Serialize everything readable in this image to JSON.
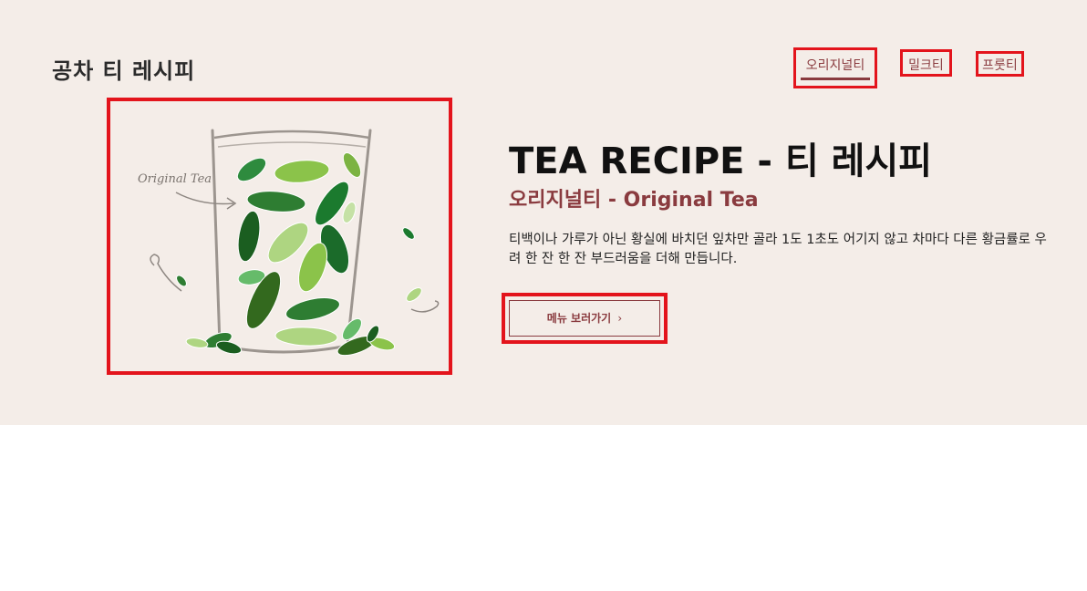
{
  "header": {
    "site_title": "공차 티 레시피"
  },
  "tabs": [
    {
      "label": "오리지널티",
      "active": true
    },
    {
      "label": "밀크티",
      "active": false
    },
    {
      "label": "프룻티",
      "active": false
    }
  ],
  "illustration": {
    "caption": "Original Tea",
    "icon": "tea-glass-with-leaves"
  },
  "hero": {
    "title": "TEA RECIPE - 티 레시피",
    "subtitle": "오리지널티 - Original Tea",
    "description": "티백이나 가루가 아닌 황실에 바치던 잎차만 골라 1도 1초도 어기지 않고 차마다 다른 황금률로 우려 한 잔 한 잔 부드러움을 더해 만듭니다.",
    "button_label": "메뉴 보러가기"
  },
  "colors": {
    "hero_bg": "#f4ede8",
    "accent": "#8a3b3f",
    "highlight_border": "#e3141c"
  }
}
